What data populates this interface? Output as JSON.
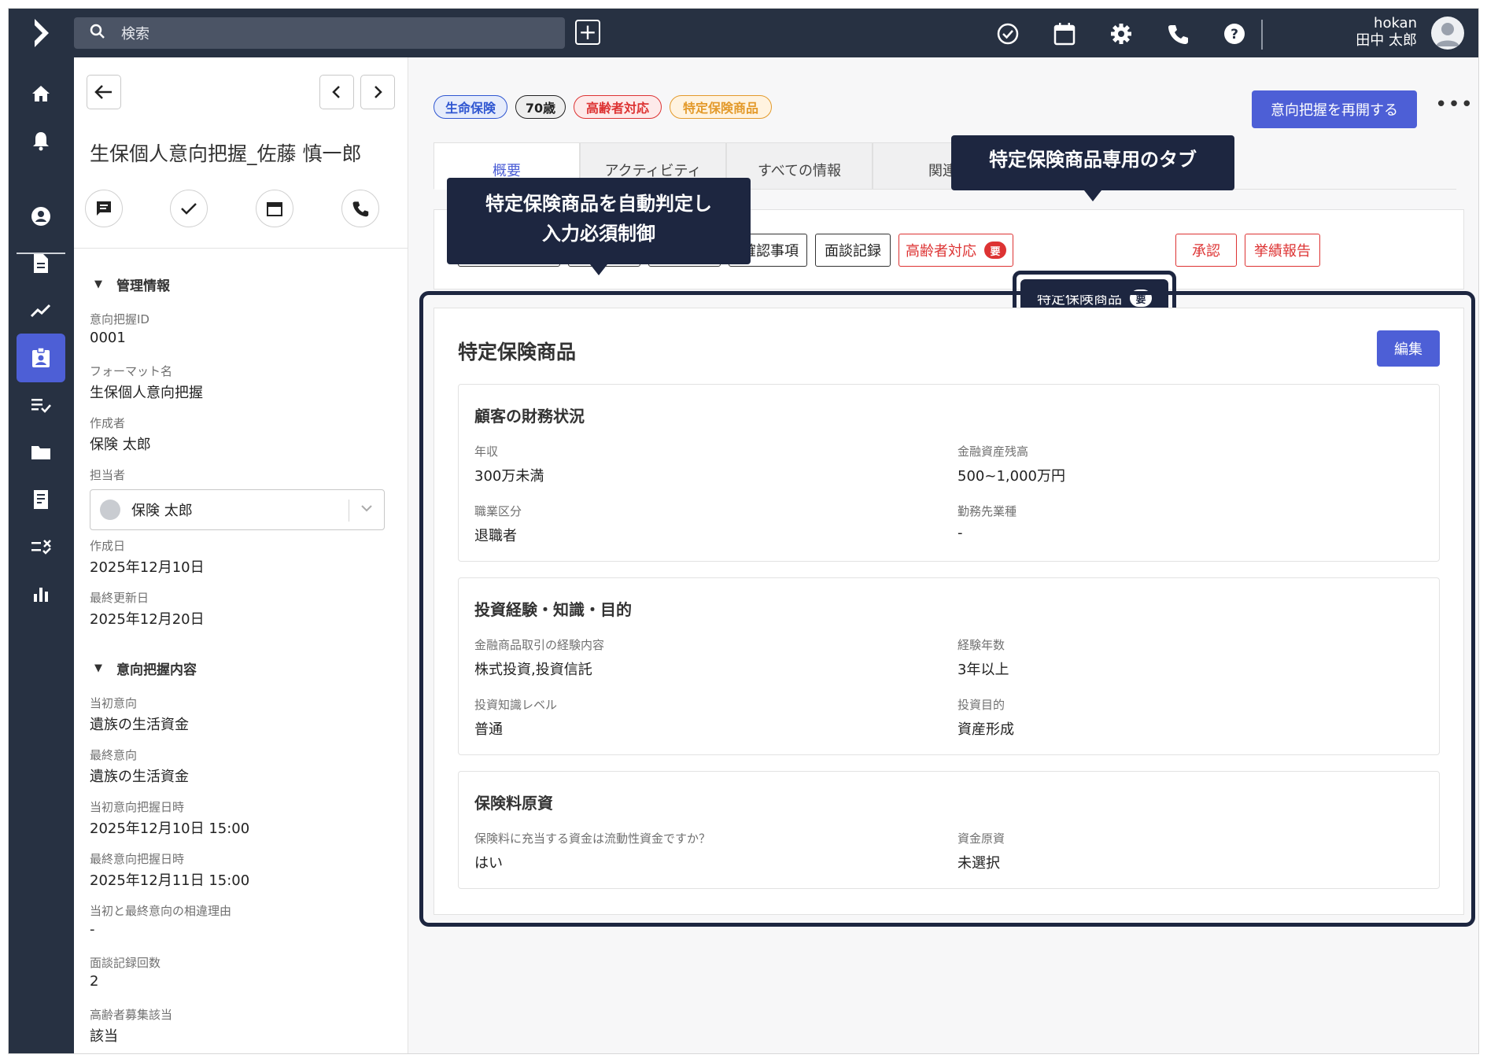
{
  "topbar": {
    "search_placeholder": "検索",
    "user_id": "hokan",
    "user_name": "田中 太郎",
    "icons": [
      "logo-chevron-icon",
      "search-icon",
      "plus-icon",
      "check-circle-icon",
      "calendar-icon",
      "gear-icon",
      "phone-icon",
      "help-icon",
      "avatar-icon"
    ]
  },
  "sidebar": {
    "items": [
      {
        "icon": "home-icon"
      },
      {
        "icon": "bell-icon"
      },
      {
        "icon": "account-circle-icon"
      },
      {
        "icon": "document-icon"
      },
      {
        "icon": "trend-icon"
      },
      {
        "icon": "badge-icon",
        "active": true
      },
      {
        "icon": "checklist-icon"
      },
      {
        "icon": "folder-icon"
      },
      {
        "icon": "receipt-icon"
      },
      {
        "icon": "rule-icon"
      },
      {
        "icon": "bar-chart-icon"
      }
    ],
    "accent_color": "#4d5fd6"
  },
  "record": {
    "title": "生保個人意向把握_佐藤 慎一郎",
    "sections": {
      "management": {
        "heading": "管理情報",
        "fields": [
          {
            "label": "意向把握ID",
            "value": "0001"
          },
          {
            "label": "フォーマット名",
            "value": "生保個人意向把握"
          },
          {
            "label": "作成者",
            "value": "保険 太郎"
          },
          {
            "label": "担当者",
            "value": "保険 太郎"
          },
          {
            "label": "作成日",
            "value": "2025年12月10日"
          },
          {
            "label": "最終更新日",
            "value": "2025年12月20日"
          }
        ]
      },
      "intent": {
        "heading": "意向把握内容",
        "fields": [
          {
            "label": "当初意向",
            "value": "遺族の生活資金"
          },
          {
            "label": "最終意向",
            "value": "遺族の生活資金"
          },
          {
            "label": "当初意向把握日時",
            "value": "2025年12月10日 15:00"
          },
          {
            "label": "最終意向把握日時",
            "value": "2025年12月11日 15:00"
          },
          {
            "label": "当初と最終意向の相違理由",
            "value": "-"
          },
          {
            "label": "面談記録回数",
            "value": "2"
          },
          {
            "label": "高齢者募集該当",
            "value": "該当"
          }
        ]
      }
    }
  },
  "badges": [
    {
      "label": "生命保険",
      "color": "#2f56d1",
      "bg": "#e6ecfb"
    },
    {
      "label": "70歳",
      "color": "#222222",
      "bg": "#eeeeee"
    },
    {
      "label": "高齢者対応",
      "color": "#d33333",
      "bg": "#fdeaea"
    },
    {
      "label": "特定保険商品",
      "color": "#e39a2b",
      "bg": "#fff3e0"
    }
  ],
  "actions": {
    "reopen": "意向把握を再開する",
    "more": "•••",
    "edit": "編集"
  },
  "tabs": [
    {
      "label": "概要",
      "active": true
    },
    {
      "label": "アクティビティ"
    },
    {
      "label": "すべての情報"
    },
    {
      "label": "関連"
    }
  ],
  "subtabs": [
    {
      "label": "確認事項",
      "style": "dark"
    },
    {
      "label": "面談記録",
      "style": "dark"
    },
    {
      "label": "高齢者対応",
      "style": "red",
      "required": "要"
    },
    {
      "label": "特定保険商品",
      "style": "highlight",
      "required": "要"
    },
    {
      "label": "承認",
      "style": "red"
    },
    {
      "label": "挙績報告",
      "style": "red"
    }
  ],
  "callouts": {
    "tab_callout": "特定保険商品専用のタブ",
    "auto_line1": "特定保険商品を自動判定し",
    "auto_line2": "入力必須制御"
  },
  "content": {
    "title": "特定保険商品",
    "cards": [
      {
        "heading": "顧客の財務状況",
        "fields": [
          {
            "label": "年収",
            "value": "300万未満"
          },
          {
            "label": "金融資産残高",
            "value": "500~1,000万円"
          },
          {
            "label": "職業区分",
            "value": "退職者"
          },
          {
            "label": "勤務先業種",
            "value": "-"
          }
        ]
      },
      {
        "heading": "投資経験・知識・目的",
        "fields": [
          {
            "label": "金融商品取引の経験内容",
            "value": "株式投資,投資信託"
          },
          {
            "label": "経験年数",
            "value": "3年以上"
          },
          {
            "label": "投資知識レベル",
            "value": "普通"
          },
          {
            "label": "投資目的",
            "value": "資産形成"
          }
        ]
      },
      {
        "heading": "保険料原資",
        "fields": [
          {
            "label": "保険料に充当する資金は流動性資金ですか？",
            "value": "はい"
          },
          {
            "label": "資金原資",
            "value": "未選択"
          }
        ]
      }
    ]
  }
}
